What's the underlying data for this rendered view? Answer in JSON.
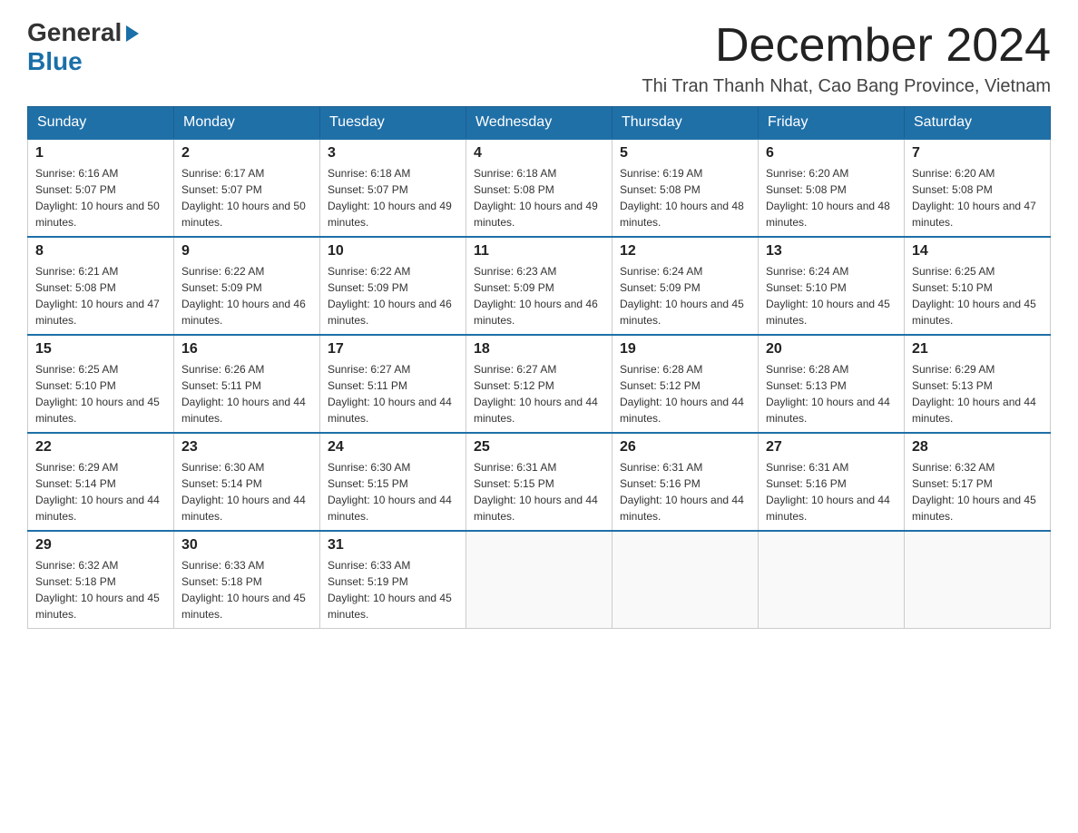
{
  "header": {
    "logo_general": "General",
    "logo_blue": "Blue",
    "month_title": "December 2024",
    "location": "Thi Tran Thanh Nhat, Cao Bang Province, Vietnam"
  },
  "days_of_week": [
    "Sunday",
    "Monday",
    "Tuesday",
    "Wednesday",
    "Thursday",
    "Friday",
    "Saturday"
  ],
  "weeks": [
    [
      {
        "day": 1,
        "sunrise": "6:16 AM",
        "sunset": "5:07 PM",
        "daylight": "10 hours and 50 minutes."
      },
      {
        "day": 2,
        "sunrise": "6:17 AM",
        "sunset": "5:07 PM",
        "daylight": "10 hours and 50 minutes."
      },
      {
        "day": 3,
        "sunrise": "6:18 AM",
        "sunset": "5:07 PM",
        "daylight": "10 hours and 49 minutes."
      },
      {
        "day": 4,
        "sunrise": "6:18 AM",
        "sunset": "5:08 PM",
        "daylight": "10 hours and 49 minutes."
      },
      {
        "day": 5,
        "sunrise": "6:19 AM",
        "sunset": "5:08 PM",
        "daylight": "10 hours and 48 minutes."
      },
      {
        "day": 6,
        "sunrise": "6:20 AM",
        "sunset": "5:08 PM",
        "daylight": "10 hours and 48 minutes."
      },
      {
        "day": 7,
        "sunrise": "6:20 AM",
        "sunset": "5:08 PM",
        "daylight": "10 hours and 47 minutes."
      }
    ],
    [
      {
        "day": 8,
        "sunrise": "6:21 AM",
        "sunset": "5:08 PM",
        "daylight": "10 hours and 47 minutes."
      },
      {
        "day": 9,
        "sunrise": "6:22 AM",
        "sunset": "5:09 PM",
        "daylight": "10 hours and 46 minutes."
      },
      {
        "day": 10,
        "sunrise": "6:22 AM",
        "sunset": "5:09 PM",
        "daylight": "10 hours and 46 minutes."
      },
      {
        "day": 11,
        "sunrise": "6:23 AM",
        "sunset": "5:09 PM",
        "daylight": "10 hours and 46 minutes."
      },
      {
        "day": 12,
        "sunrise": "6:24 AM",
        "sunset": "5:09 PM",
        "daylight": "10 hours and 45 minutes."
      },
      {
        "day": 13,
        "sunrise": "6:24 AM",
        "sunset": "5:10 PM",
        "daylight": "10 hours and 45 minutes."
      },
      {
        "day": 14,
        "sunrise": "6:25 AM",
        "sunset": "5:10 PM",
        "daylight": "10 hours and 45 minutes."
      }
    ],
    [
      {
        "day": 15,
        "sunrise": "6:25 AM",
        "sunset": "5:10 PM",
        "daylight": "10 hours and 45 minutes."
      },
      {
        "day": 16,
        "sunrise": "6:26 AM",
        "sunset": "5:11 PM",
        "daylight": "10 hours and 44 minutes."
      },
      {
        "day": 17,
        "sunrise": "6:27 AM",
        "sunset": "5:11 PM",
        "daylight": "10 hours and 44 minutes."
      },
      {
        "day": 18,
        "sunrise": "6:27 AM",
        "sunset": "5:12 PM",
        "daylight": "10 hours and 44 minutes."
      },
      {
        "day": 19,
        "sunrise": "6:28 AM",
        "sunset": "5:12 PM",
        "daylight": "10 hours and 44 minutes."
      },
      {
        "day": 20,
        "sunrise": "6:28 AM",
        "sunset": "5:13 PM",
        "daylight": "10 hours and 44 minutes."
      },
      {
        "day": 21,
        "sunrise": "6:29 AM",
        "sunset": "5:13 PM",
        "daylight": "10 hours and 44 minutes."
      }
    ],
    [
      {
        "day": 22,
        "sunrise": "6:29 AM",
        "sunset": "5:14 PM",
        "daylight": "10 hours and 44 minutes."
      },
      {
        "day": 23,
        "sunrise": "6:30 AM",
        "sunset": "5:14 PM",
        "daylight": "10 hours and 44 minutes."
      },
      {
        "day": 24,
        "sunrise": "6:30 AM",
        "sunset": "5:15 PM",
        "daylight": "10 hours and 44 minutes."
      },
      {
        "day": 25,
        "sunrise": "6:31 AM",
        "sunset": "5:15 PM",
        "daylight": "10 hours and 44 minutes."
      },
      {
        "day": 26,
        "sunrise": "6:31 AM",
        "sunset": "5:16 PM",
        "daylight": "10 hours and 44 minutes."
      },
      {
        "day": 27,
        "sunrise": "6:31 AM",
        "sunset": "5:16 PM",
        "daylight": "10 hours and 44 minutes."
      },
      {
        "day": 28,
        "sunrise": "6:32 AM",
        "sunset": "5:17 PM",
        "daylight": "10 hours and 45 minutes."
      }
    ],
    [
      {
        "day": 29,
        "sunrise": "6:32 AM",
        "sunset": "5:18 PM",
        "daylight": "10 hours and 45 minutes."
      },
      {
        "day": 30,
        "sunrise": "6:33 AM",
        "sunset": "5:18 PM",
        "daylight": "10 hours and 45 minutes."
      },
      {
        "day": 31,
        "sunrise": "6:33 AM",
        "sunset": "5:19 PM",
        "daylight": "10 hours and 45 minutes."
      },
      null,
      null,
      null,
      null
    ]
  ],
  "labels": {
    "sunrise_prefix": "Sunrise: ",
    "sunset_prefix": "Sunset: ",
    "daylight_prefix": "Daylight: "
  }
}
